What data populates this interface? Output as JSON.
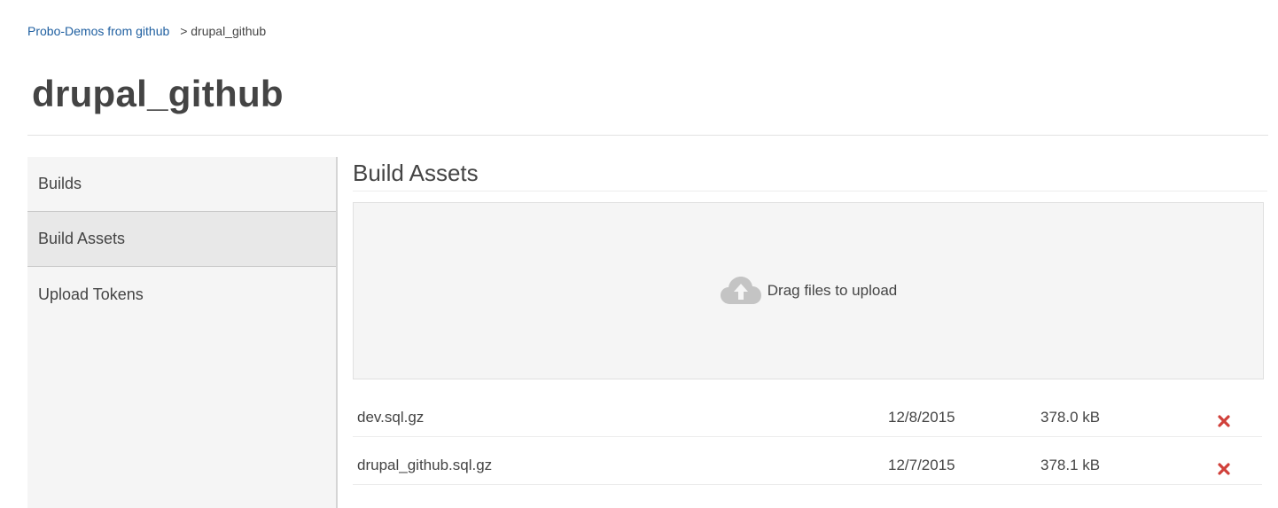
{
  "breadcrumb": {
    "parent_label": "Probo-Demos from github",
    "separator": ">",
    "current_label": "drupal_github"
  },
  "page": {
    "title": "drupal_github"
  },
  "sidebar": {
    "items": [
      {
        "label": "Builds",
        "active": false
      },
      {
        "label": "Build Assets",
        "active": true
      },
      {
        "label": "Upload Tokens",
        "active": false
      }
    ]
  },
  "main": {
    "section_title": "Build Assets",
    "dropzone": {
      "icon": "cloud-upload-icon",
      "text": "Drag files to upload"
    },
    "assets": [
      {
        "name": "dev.sql.gz",
        "date": "12/8/2015",
        "size": "378.0 kB",
        "delete_icon": "delete-x-icon"
      },
      {
        "name": "drupal_github.sql.gz",
        "date": "12/7/2015",
        "size": "378.1 kB",
        "delete_icon": "delete-x-icon"
      }
    ]
  },
  "colors": {
    "link": "#1f5fa0",
    "text": "#444444",
    "delete": "#d0403a",
    "sidebar_bg": "#f5f5f5",
    "sidebar_active_bg": "#e8e8e8"
  }
}
